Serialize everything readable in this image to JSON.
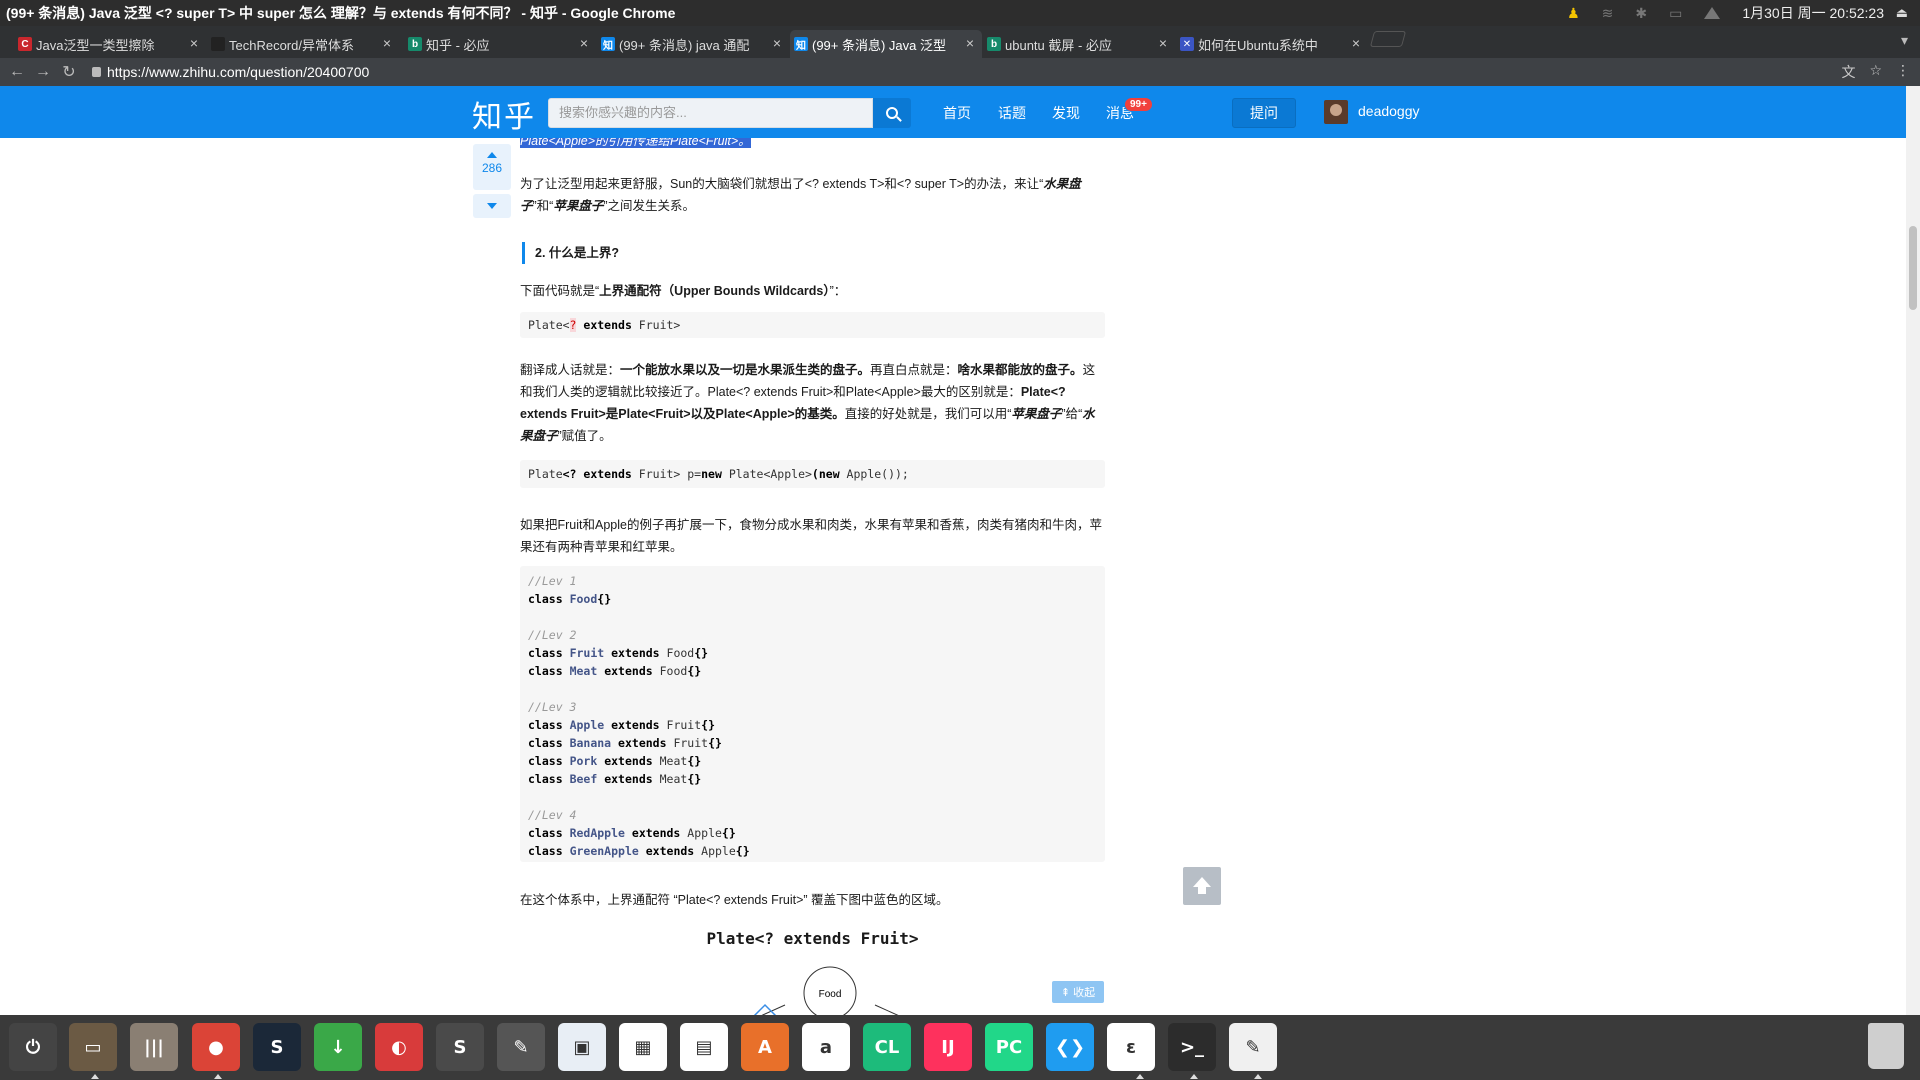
{
  "window": {
    "title": "(99+ 条消息) Java 泛型 <? super T> 中 super 怎么 理解？与 extends 有何不同？ - 知乎 - Google Chrome",
    "clock": "1月30日 周一 20:52:23"
  },
  "tabs": [
    {
      "label": "Java泛型一类型擦除",
      "favicon": "csdn-icon",
      "color": "#c9272d",
      "glyph": "C",
      "active": false
    },
    {
      "label": "TechRecord/异常体系",
      "favicon": "github-icon",
      "color": "#222222",
      "glyph": "",
      "active": false
    },
    {
      "label": "知乎 - 必应",
      "favicon": "bing-icon",
      "color": "#168a6b",
      "glyph": "b",
      "active": false
    },
    {
      "label": "(99+ 条消息) java 通配",
      "favicon": "zhihu-icon",
      "color": "#0f88eb",
      "glyph": "知",
      "active": false
    },
    {
      "label": "(99+ 条消息) Java 泛型",
      "favicon": "zhihu-icon",
      "color": "#0f88eb",
      "glyph": "知",
      "active": true
    },
    {
      "label": "ubuntu 截屏 - 必应",
      "favicon": "bing-icon",
      "color": "#168a6b",
      "glyph": "b",
      "active": false
    },
    {
      "label": "如何在Ubuntu系统中",
      "favicon": "jianshu-icon",
      "color": "#3b55c4",
      "glyph": "✕",
      "active": false
    }
  ],
  "address": {
    "url": "https://www.zhihu.com/question/20400700"
  },
  "zhihu": {
    "logo": "知乎",
    "search_placeholder": "搜索你感兴趣的内容...",
    "nav": [
      "首页",
      "话题",
      "发现",
      "消息"
    ],
    "badge": "99+",
    "ask": "提问",
    "username": "deadoggy",
    "brand_color": "#0f88eb"
  },
  "vote": {
    "count": "286"
  },
  "article": {
    "selected_text": "Plate<Apple>的引用传递给Plate<Fruit>。",
    "p1_before": "为了让泛型用起来更舒服，Sun的大脑袋们就想出了<? extends T>和<? super T>的办法，来让“",
    "p1_em1": "水果盘子",
    "p1_mid": "”和“",
    "p1_em2": "苹果盘子",
    "p1_after": "”之间发生关系。",
    "heading": "2. 什么是上界?",
    "p2_before": "下面代码就是“",
    "p2_bold": "上界通配符（Upper Bounds Wildcards）",
    "p2_after": "”：",
    "code1_plate": "Plate<",
    "code1_q": "?",
    "code1_extends": " extends",
    "code1_rest": " Fruit>",
    "p3_a": "翻译成人话就是：",
    "p3_b": "一个能放水果以及一切是水果派生类的盘子。",
    "p3_c": "再直白点就是：",
    "p3_d": "啥水果都能放的盘子。",
    "p3_e": "这和我们人类的逻辑就比较接近了。Plate<?  extends Fruit>和Plate<Apple>最大的区别就是：",
    "p3_f": "Plate<?  extends Fruit>是Plate<Fruit>以及Plate<Apple>的基类。",
    "p3_g": "直接的好处就是，我们可以用“",
    "p3_h": "苹果盘子",
    "p3_i": "”给“",
    "p3_j": "水果盘子",
    "p3_k": "”赋值了。",
    "code2_a": "Plate",
    "code2_b": "<? extends",
    "code2_c": " Fruit> p=",
    "code2_d": "new",
    "code2_e": " Plate<Apple>",
    "code2_f": "(new",
    "code2_g": " Apple());",
    "p4": "如果把Fruit和Apple的例子再扩展一下，食物分成水果和肉类，水果有苹果和香蕉，肉类有猪肉和牛肉，苹果还有两种青苹果和红苹果。",
    "code3": [
      {
        "type": "comment",
        "text": "//Lev 1"
      },
      {
        "type": "class",
        "name": "Food",
        "ext": ""
      },
      {
        "type": "blank"
      },
      {
        "type": "comment",
        "text": "//Lev 2"
      },
      {
        "type": "class",
        "name": "Fruit",
        "ext": "Food"
      },
      {
        "type": "class",
        "name": "Meat",
        "ext": "Food"
      },
      {
        "type": "blank"
      },
      {
        "type": "comment",
        "text": "//Lev 3"
      },
      {
        "type": "class",
        "name": "Apple",
        "ext": "Fruit"
      },
      {
        "type": "class",
        "name": "Banana",
        "ext": "Fruit"
      },
      {
        "type": "class",
        "name": "Pork",
        "ext": "Meat"
      },
      {
        "type": "class",
        "name": "Beef",
        "ext": "Meat"
      },
      {
        "type": "blank"
      },
      {
        "type": "comment",
        "text": "//Lev 4"
      },
      {
        "type": "class",
        "name": "RedApple",
        "ext": "Apple"
      },
      {
        "type": "class",
        "name": "GreenApple",
        "ext": "Apple"
      }
    ],
    "kw_class": "class",
    "kw_extends": "extends",
    "braces": "{}",
    "p5": "在这个体系中，上界通配符 “Plate<?  extends Fruit>” 覆盖下图中蓝色的区域。",
    "diagram_title": "Plate<? extends Fruit>",
    "diagram_node": "Food",
    "fold": "收起"
  },
  "dock": [
    {
      "name": "system-settings-icon",
      "color": "#444444",
      "glyph": "⏻"
    },
    {
      "name": "files-icon",
      "color": "#6b5a44",
      "glyph": "▭"
    },
    {
      "name": "mixer-icon",
      "color": "#8a7f73",
      "glyph": "|||"
    },
    {
      "name": "chrome-icon",
      "color": "#db4437",
      "glyph": "●"
    },
    {
      "name": "steam-icon",
      "color": "#1b2838",
      "glyph": "S"
    },
    {
      "name": "download-icon",
      "color": "#3aa848",
      "glyph": "↓"
    },
    {
      "name": "netease-music-icon",
      "color": "#d83b3b",
      "glyph": "◐"
    },
    {
      "name": "sublime-icon",
      "color": "#4a4a4a",
      "glyph": "S"
    },
    {
      "name": "tools-icon",
      "color": "#555555",
      "glyph": "✎"
    },
    {
      "name": "image-viewer-icon",
      "color": "#e8eef5",
      "glyph": "▣"
    },
    {
      "name": "spreadsheet-icon",
      "color": "#ffffff",
      "glyph": "▦"
    },
    {
      "name": "presentation-icon",
      "color": "#ffffff",
      "glyph": "▤"
    },
    {
      "name": "software-center-icon",
      "color": "#e8702a",
      "glyph": "A"
    },
    {
      "name": "amazon-icon",
      "color": "#ffffff",
      "glyph": "a"
    },
    {
      "name": "clion-icon",
      "color": "#1dbb7b",
      "glyph": "CL"
    },
    {
      "name": "intellij-icon",
      "color": "#fe315d",
      "glyph": "IJ"
    },
    {
      "name": "pycharm-icon",
      "color": "#21d789",
      "glyph": "PC"
    },
    {
      "name": "vscode-icon",
      "color": "#1f9cf0",
      "glyph": "❮❯"
    },
    {
      "name": "draw-icon",
      "color": "#ffffff",
      "glyph": "ε"
    },
    {
      "name": "terminal-icon",
      "color": "#2c2c2c",
      "glyph": ">_"
    },
    {
      "name": "text-editor-icon",
      "color": "#f0f0f0",
      "glyph": "✎"
    }
  ]
}
